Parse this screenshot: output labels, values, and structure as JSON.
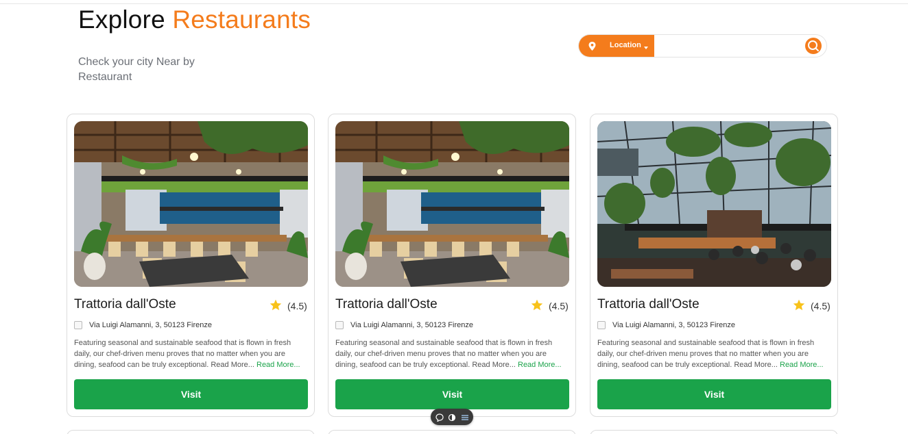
{
  "header": {
    "title_prefix": "Explore",
    "title_accent": "Restaurants",
    "subtitle": "Check your city Near by Restaurant"
  },
  "search": {
    "location_label": "Location",
    "placeholder": ""
  },
  "cards": [
    {
      "name": "Trattoria dall'Oste",
      "rating": "(4.5)",
      "address": "Via Luigi Alamanni, 3, 50123 Firenze",
      "description": "Featuring seasonal and sustainable seafood that is flown in fresh daily, our chef-driven menu proves that no matter when you are dining, seafood can be truly exceptional. Read More...",
      "read_more": "Read More...",
      "button": "Visit",
      "image": "restaurant-interior-green-wall"
    },
    {
      "name": "Trattoria dall'Oste",
      "rating": "(4.5)",
      "address": "Via Luigi Alamanni, 3, 50123 Firenze",
      "description": "Featuring seasonal and sustainable seafood that is flown in fresh daily, our chef-driven menu proves that no matter when you are dining, seafood can be truly exceptional. Read More...",
      "read_more": "Read More...",
      "button": "Visit",
      "image": "restaurant-interior-green-wall"
    },
    {
      "name": "Trattoria dall'Oste",
      "rating": "(4.5)",
      "address": "Via Luigi Alamanni, 3, 50123 Firenze",
      "description": "Featuring seasonal and sustainable seafood that is flown in fresh daily, our chef-driven menu proves that no matter when you are dining, seafood can be truly exceptional. Read More...",
      "read_more": "Read More...",
      "button": "Visit",
      "image": "greenhouse-restaurant-plants"
    }
  ],
  "colors": {
    "accent": "#f47c1c",
    "button": "#1aa34a",
    "star": "#f8c21a"
  },
  "icons": [
    "location-pin-icon",
    "caret-down-icon",
    "search-icon",
    "star-icon",
    "broken-image-icon",
    "chat-icon",
    "theme-toggle-icon",
    "list-icon"
  ]
}
